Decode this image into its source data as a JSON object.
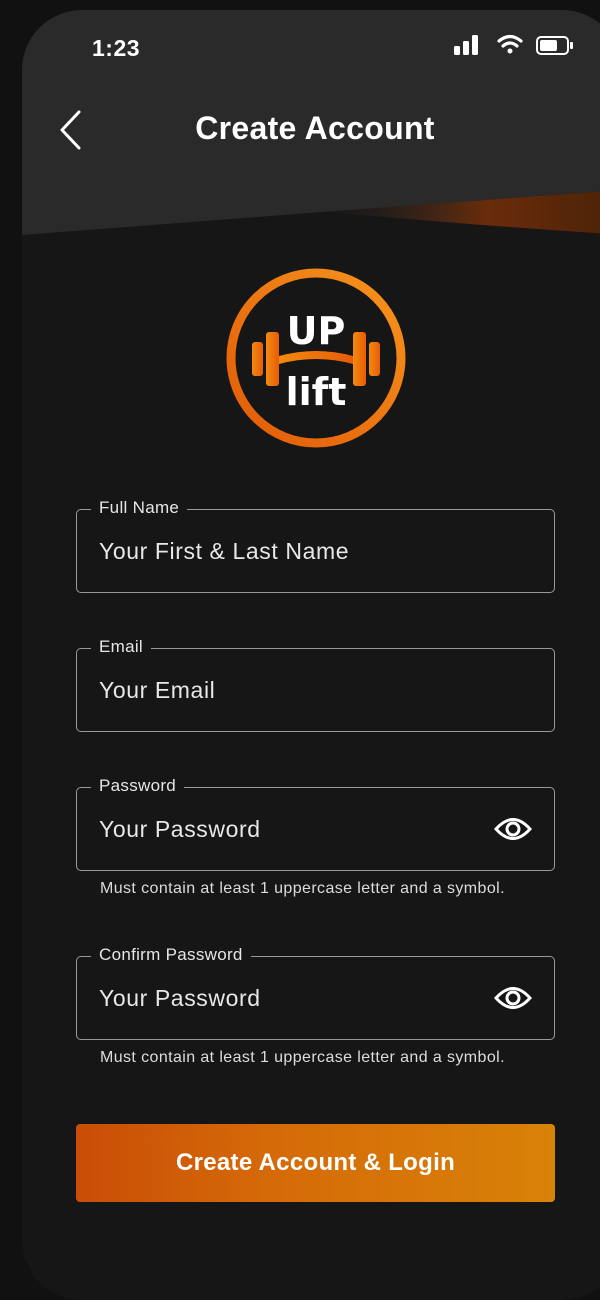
{
  "status_bar": {
    "time": "1:23",
    "icons": [
      "signal-icon",
      "wifi-icon",
      "battery-icon"
    ]
  },
  "header": {
    "title": "Create Account",
    "back_icon": "chevron-left-icon"
  },
  "logo": {
    "line1": "UP",
    "line2": "lift"
  },
  "form": {
    "full_name": {
      "label": "Full Name",
      "placeholder": "Your First & Last Name"
    },
    "email": {
      "label": "Email",
      "placeholder": "Your Email"
    },
    "password": {
      "label": "Password",
      "placeholder": "Your Password",
      "hint": "Must contain at least 1 uppercase letter and a symbol.",
      "icon": "eye-icon"
    },
    "confirm_password": {
      "label": "Confirm Password",
      "placeholder": "Your Password",
      "hint": "Must contain at least 1 uppercase letter and a symbol.",
      "icon": "eye-icon"
    }
  },
  "cta": {
    "label": "Create Account & Login"
  },
  "colors": {
    "background": "#161616",
    "header": "#2a2a2a",
    "accent": "#f07a08",
    "accent_dark": "#c94d06"
  }
}
